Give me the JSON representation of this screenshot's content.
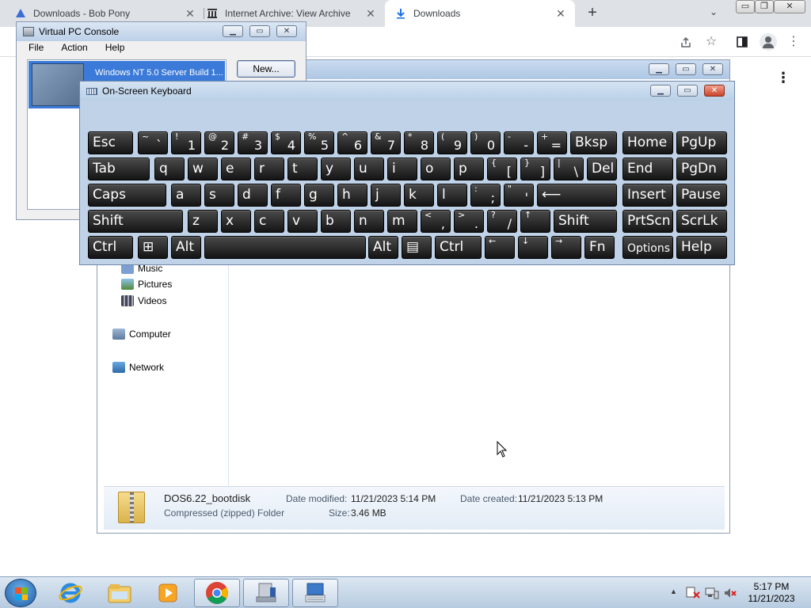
{
  "browser": {
    "tabs": [
      {
        "title": "Downloads - Bob Pony",
        "icon": "bob-pony-icon"
      },
      {
        "title": "Internet Archive: View Archive",
        "icon": "archive-icon"
      },
      {
        "title": "Downloads",
        "icon": "download-icon"
      }
    ],
    "new_tab": "+",
    "tab_search": "⌄",
    "menu": "⋮"
  },
  "host_window": {
    "min": "▭",
    "restore": "❐",
    "close": "✕"
  },
  "vpc_console": {
    "title": "Virtual PC Console",
    "menu": [
      "File",
      "Action",
      "Help"
    ],
    "vm_name": "Windows  NT 5.0 Server Build 1...",
    "new_button": "New..."
  },
  "osk": {
    "title": "On-Screen Keyboard",
    "rows": [
      [
        {
          "l": "Esc"
        },
        {
          "u": "~",
          "d": "`"
        },
        {
          "u": "!",
          "d": "1"
        },
        {
          "u": "@",
          "d": "2"
        },
        {
          "u": "#",
          "d": "3"
        },
        {
          "u": "$",
          "d": "4"
        },
        {
          "u": "%",
          "d": "5"
        },
        {
          "u": "^",
          "d": "6"
        },
        {
          "u": "&",
          "d": "7"
        },
        {
          "u": "*",
          "d": "8"
        },
        {
          "u": "(",
          "d": "9"
        },
        {
          "u": ")",
          "d": "0"
        },
        {
          "u": "-",
          "d": "-"
        },
        {
          "u": "+",
          "d": "="
        },
        {
          "l": "Bksp"
        },
        {
          "l": "Home"
        },
        {
          "l": "PgUp"
        }
      ],
      [
        {
          "l": "Tab"
        },
        {
          "l": "q"
        },
        {
          "l": "w"
        },
        {
          "l": "e"
        },
        {
          "l": "r"
        },
        {
          "l": "t"
        },
        {
          "l": "y"
        },
        {
          "l": "u"
        },
        {
          "l": "i"
        },
        {
          "l": "o"
        },
        {
          "l": "p"
        },
        {
          "u": "{",
          "d": "["
        },
        {
          "u": "}",
          "d": "]"
        },
        {
          "u": "|",
          "d": "\\"
        },
        {
          "l": "Del"
        },
        {
          "l": "End"
        },
        {
          "l": "PgDn"
        }
      ],
      [
        {
          "l": "Caps"
        },
        {
          "l": "a"
        },
        {
          "l": "s"
        },
        {
          "l": "d"
        },
        {
          "l": "f"
        },
        {
          "l": "g"
        },
        {
          "l": "h"
        },
        {
          "l": "j"
        },
        {
          "l": "k"
        },
        {
          "l": "l"
        },
        {
          "u": ":",
          "d": ";"
        },
        {
          "u": "\"",
          "d": "'"
        },
        {
          "l": "⟵"
        },
        {
          "l": "Insert"
        },
        {
          "l": "Pause"
        }
      ],
      [
        {
          "l": "Shift"
        },
        {
          "l": "z"
        },
        {
          "l": "x"
        },
        {
          "l": "c"
        },
        {
          "l": "v"
        },
        {
          "l": "b"
        },
        {
          "l": "n"
        },
        {
          "l": "m"
        },
        {
          "u": "<",
          "d": ","
        },
        {
          "u": ">",
          "d": "."
        },
        {
          "u": "?",
          "d": "/"
        },
        {
          "u": "↑",
          "d": ""
        },
        {
          "l": "Shift"
        },
        {
          "l": "PrtScn"
        },
        {
          "l": "ScrLk"
        }
      ],
      [
        {
          "l": "Ctrl"
        },
        {
          "l": "⊞"
        },
        {
          "l": "Alt"
        },
        {
          "l": ""
        },
        {
          "l": "Alt"
        },
        {
          "l": "▤"
        },
        {
          "l": "Ctrl"
        },
        {
          "u": "←",
          "d": ""
        },
        {
          "u": "↓",
          "d": ""
        },
        {
          "u": "→",
          "d": ""
        },
        {
          "l": "Fn"
        },
        {
          "l": "Options"
        },
        {
          "l": "Help"
        }
      ]
    ]
  },
  "explorer": {
    "nav": [
      {
        "label": "Music",
        "icon": "music-icon"
      },
      {
        "label": "Pictures",
        "icon": "pictures-icon"
      },
      {
        "label": "Videos",
        "icon": "videos-icon"
      },
      {
        "label": "Computer",
        "icon": "computer-icon"
      },
      {
        "label": "Network",
        "icon": "network-icon"
      }
    ],
    "details": {
      "name": "DOS6.22_bootdisk",
      "type": "Compressed (zipped) Folder",
      "modified_label": "Date modified:",
      "modified_value": "11/21/2023 5:14 PM",
      "size_label": "Size:",
      "size_value": "3.46 MB",
      "created_label": "Date created:",
      "created_value": "11/21/2023 5:13 PM"
    }
  },
  "taskbar": {
    "items": [
      "internet-explorer-icon",
      "windows-explorer-icon",
      "media-player-icon",
      "chrome-icon",
      "virtual-pc-icon",
      "on-screen-keyboard-icon"
    ],
    "tray_arrow": "▲",
    "time": "5:17 PM",
    "date": "11/21/2023"
  }
}
